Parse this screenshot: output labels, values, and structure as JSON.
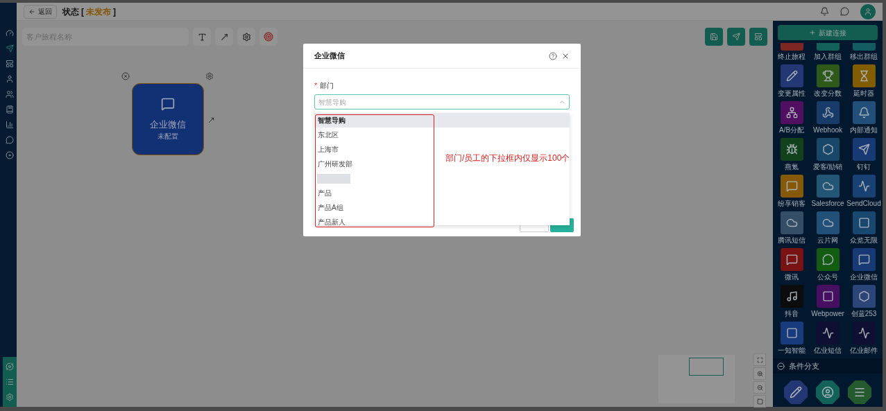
{
  "header": {
    "back_label": "返回",
    "status_label": "状态",
    "bracket_open": "[",
    "status_value": "未发布",
    "bracket_close": "]"
  },
  "toolbar": {
    "name_placeholder": "客户旅程名称"
  },
  "canvas_node": {
    "title": "企业微信",
    "subtitle": "未配置"
  },
  "palette": {
    "new_connection": "新建连接",
    "items": [
      {
        "label": "终止旅程",
        "color": "#7e2622"
      },
      {
        "label": "加入群组",
        "color": "#126259"
      },
      {
        "label": "移出群组",
        "color": "#125c61"
      },
      {
        "label": "变更属性",
        "color": "#223774"
      },
      {
        "label": "改变分数",
        "color": "#2e5918"
      },
      {
        "label": "延时器",
        "color": "#825d00"
      },
      {
        "label": "A/B分配",
        "color": "#500f61"
      },
      {
        "label": "Webhook",
        "color": "#183c6a"
      },
      {
        "label": "内部通知",
        "color": "#224f79"
      },
      {
        "label": "燕氪",
        "color": "#11421c"
      },
      {
        "label": "爱客/励销",
        "color": "#18476a"
      },
      {
        "label": "钉钉",
        "color": "#183a74"
      },
      {
        "label": "纷享销客",
        "color": "#865909"
      },
      {
        "label": "Salesforce",
        "color": "#225674"
      },
      {
        "label": "SendCloud",
        "color": "#184174"
      },
      {
        "label": "腾讯短信",
        "color": "#344e66"
      },
      {
        "label": "云片网",
        "color": "#225079"
      },
      {
        "label": "众览无限",
        "color": "#18486f"
      },
      {
        "label": "微讯",
        "color": "#791313"
      },
      {
        "label": "公众号",
        "color": "#135d13"
      },
      {
        "label": "企业微信",
        "color": "#183a74"
      },
      {
        "label": "抖音",
        "color": "#0c0c0c"
      },
      {
        "label": "Webpower",
        "color": "#460f61"
      },
      {
        "label": "创蓝253",
        "color": "#2b4579"
      },
      {
        "label": "一知智能",
        "color": "#183b7d"
      },
      {
        "label": "亿业短信",
        "color": "#0f0f33"
      },
      {
        "label": "亿业邮件",
        "color": "#0f0f33"
      }
    ],
    "section_title": "条件分支",
    "section_items": [
      {
        "color": "#223774"
      },
      {
        "color": "#126259"
      },
      {
        "color": "#25592e"
      }
    ]
  },
  "modal": {
    "title": "企业微信",
    "required_mark": "*",
    "field_label": "部门",
    "select_placeholder": "智慧导购",
    "expanded": true,
    "options": [
      {
        "kind": "text",
        "label": "智慧导购",
        "selected": true
      },
      {
        "kind": "text",
        "label": "东北区",
        "selected": false
      },
      {
        "kind": "text",
        "label": "上海市",
        "selected": false
      },
      {
        "kind": "text",
        "label": "广州研发部",
        "selected": false
      },
      {
        "kind": "redacted",
        "selected": false
      },
      {
        "kind": "text",
        "label": "产品",
        "selected": false
      },
      {
        "kind": "text",
        "label": "产品A组",
        "selected": false
      },
      {
        "kind": "text",
        "label": "产品新人",
        "selected": false
      }
    ]
  },
  "annotation": {
    "text": "部门/员工的下拉框内仅显示100个"
  }
}
